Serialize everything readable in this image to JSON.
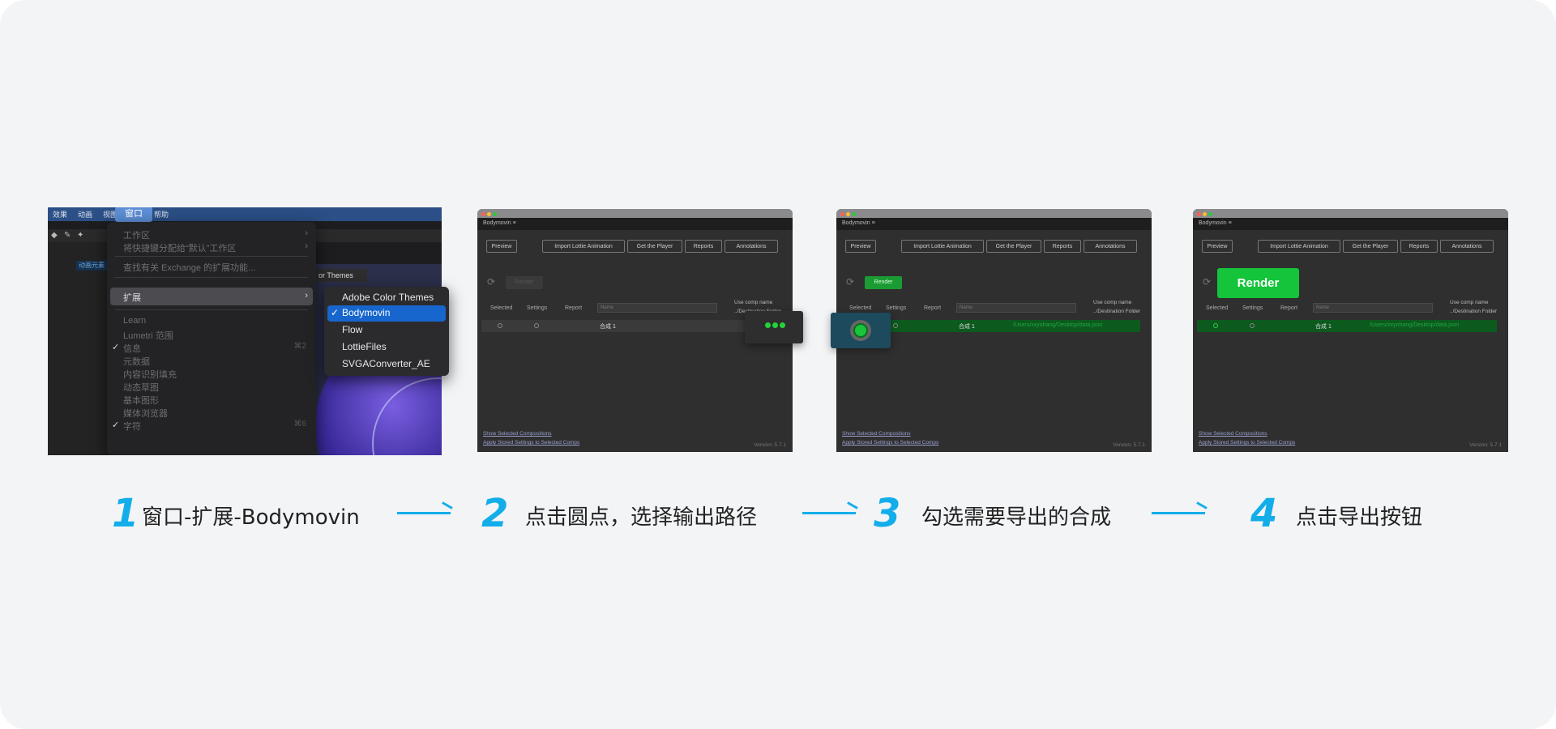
{
  "step1": {
    "menubar": [
      "效果",
      "动画",
      "视图",
      "窗口",
      "帮助"
    ],
    "active_menu": "窗口",
    "tag": "动画元素",
    "tab_themes": "or Themes",
    "menu_items": [
      {
        "label": "工作区",
        "arrow": "›"
      },
      {
        "label": "将快捷键分配给“默认”工作区",
        "arrow": "›"
      },
      {
        "label": "查找有关 Exchange 的扩展功能..."
      },
      {
        "label": "扩展",
        "arrow": "›"
      },
      {
        "label": "Learn"
      },
      {
        "label": "Lumetri 范围"
      },
      {
        "label": "信息",
        "check": "✓",
        "shortcut": "⌘2"
      },
      {
        "label": "元数据"
      },
      {
        "label": "内容识别填充"
      },
      {
        "label": "动态草图"
      },
      {
        "label": "基本图形"
      },
      {
        "label": "媒体浏览器"
      },
      {
        "label": "字符",
        "check": "✓",
        "shortcut": "⌘6"
      }
    ],
    "submenu": [
      "Adobe Color Themes",
      "Bodymovin",
      "Flow",
      "LottieFiles",
      "SVGAConverter_AE"
    ],
    "submenu_selected": "Bodymovin",
    "submenu_check": "✓"
  },
  "panel": {
    "tab": "Bodymovin ≡",
    "buttons": [
      "Preview",
      "Import Lottie Animation",
      "Get the Player",
      "Reports",
      "Annotations"
    ],
    "render": "Render",
    "columns": [
      "Selected",
      "Settings",
      "Report"
    ],
    "name_placeholder": "Name",
    "use_comp_name": "Use comp name",
    "destination": "../Destination Folder",
    "comp": "合成 1",
    "path": "/Users/xxyohang/Desktop/data.json",
    "footer1": "Show Selected Compositions",
    "footer2": "Apply Stored Settings to Selected Comps",
    "version": "Version: 5.7.1"
  },
  "captions": [
    {
      "num": "1",
      "text": "窗口-扩展-Bodymovin"
    },
    {
      "num": "2",
      "text": "点击圆点，选择输出路径"
    },
    {
      "num": "3",
      "text": "勾选需要导出的合成"
    },
    {
      "num": "4",
      "text": "点击导出按钮"
    }
  ],
  "colors": {
    "accent": "#13aeea",
    "render_green": "#14c43a",
    "menu_selected": "#1766cd"
  }
}
